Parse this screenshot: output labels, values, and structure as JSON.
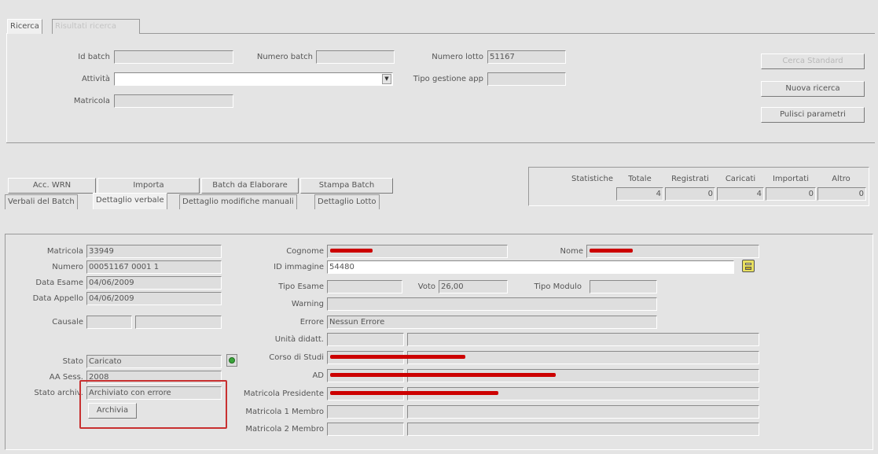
{
  "top_tabs": [
    "Ricerca",
    "Risultati ricerca"
  ],
  "search": {
    "id_batch_label": "Id batch",
    "id_batch_value": "",
    "numero_batch_label": "Numero batch",
    "numero_batch_value": "",
    "numero_lotto_label": "Numero lotto",
    "numero_lotto_value": "51167",
    "attivita_label": "Attività",
    "attivita_value": "",
    "tipo_gestione_label": "Tipo gestione app",
    "tipo_gestione_value": "",
    "matricola_label": "Matricola",
    "matricola_value": ""
  },
  "side_buttons": {
    "cerca": "Cerca Standard",
    "nuova": "Nuova ricerca",
    "pulisci": "Pulisci parametri"
  },
  "action_buttons": {
    "acc_wrn": "Acc. WRN",
    "importa": "Importa",
    "batch_elab": "Batch da Elaborare",
    "stampa": "Stampa Batch"
  },
  "stats": {
    "label": "Statistiche",
    "headers": [
      "Totale",
      "Registrati",
      "Caricati",
      "Importati",
      "Altro"
    ],
    "values": [
      "4",
      "0",
      "4",
      "0",
      "0"
    ]
  },
  "detail_tabs": [
    "Verbali del Batch",
    "Dettaglio verbale",
    "Dettaglio modifiche manuali",
    "Dettaglio Lotto"
  ],
  "detail": {
    "matricola_label": "Matricola",
    "matricola_value": "33949",
    "numero_label": "Numero",
    "numero_value": "00051167 0001 1",
    "data_esame_label": "Data Esame",
    "data_esame_value": "04/06/2009",
    "data_appello_label": "Data Appello",
    "data_appello_value": "04/06/2009",
    "causale_label": "Causale",
    "stato_label": "Stato",
    "stato_value": "Caricato",
    "aa_sess_label": "AA Sess.",
    "aa_sess_value": "2008",
    "stato_archiv_label": "Stato archiv.",
    "stato_archiv_value": "Archiviato con errore",
    "archivia_button": "Archivia",
    "cognome_label": "Cognome",
    "nome_label": "Nome",
    "id_immagine_label": "ID immagine",
    "id_immagine_value": "54480",
    "tipo_esame_label": "Tipo Esame",
    "tipo_esame_value": "",
    "voto_label": "Voto",
    "voto_value": "26,00",
    "tipo_modulo_label": "Tipo Modulo",
    "tipo_modulo_value": "",
    "warning_label": "Warning",
    "warning_value": "",
    "errore_label": "Errore",
    "errore_value": "Nessun Errore",
    "unita_label": "Unità didatt.",
    "corso_label": "Corso di Studi",
    "ad_label": "AD",
    "presidente_label": "Matricola Presidente",
    "membro1_label": "Matricola 1 Membro",
    "membro2_label": "Matricola 2 Membro"
  },
  "colors": {
    "redaction": "#cc0000",
    "highlight_box": "#c83030",
    "status_dot": "#3aa43a"
  }
}
